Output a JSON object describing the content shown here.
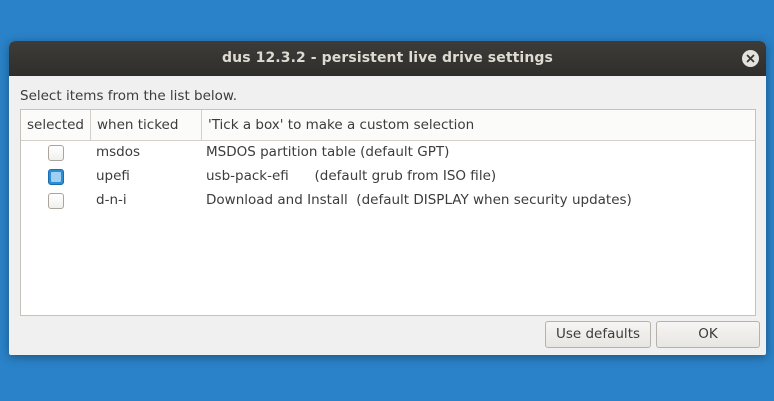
{
  "window": {
    "title": "dus 12.3.2 - persistent live drive settings"
  },
  "instructions": "Select items from the list below.",
  "list": {
    "columns": [
      "selected",
      "when ticked",
      "'Tick a box' to make a custom selection"
    ],
    "rows": [
      {
        "checked": false,
        "key": "msdos",
        "description": "MSDOS partition table (default GPT)"
      },
      {
        "checked": true,
        "key": "upefi",
        "description": "usb-pack-efi      (default grub from ISO file)"
      },
      {
        "checked": false,
        "key": "d-n-i",
        "description": "Download and Install  (default DISPLAY when security updates)"
      }
    ]
  },
  "buttons": {
    "use_defaults": "Use defaults",
    "ok": "OK"
  },
  "colors": {
    "desktop": "#2a82c8",
    "titlebar": "#3d3c39",
    "checkbox_checked": "#2c8fd6"
  },
  "icons": {
    "close": "close-icon"
  }
}
